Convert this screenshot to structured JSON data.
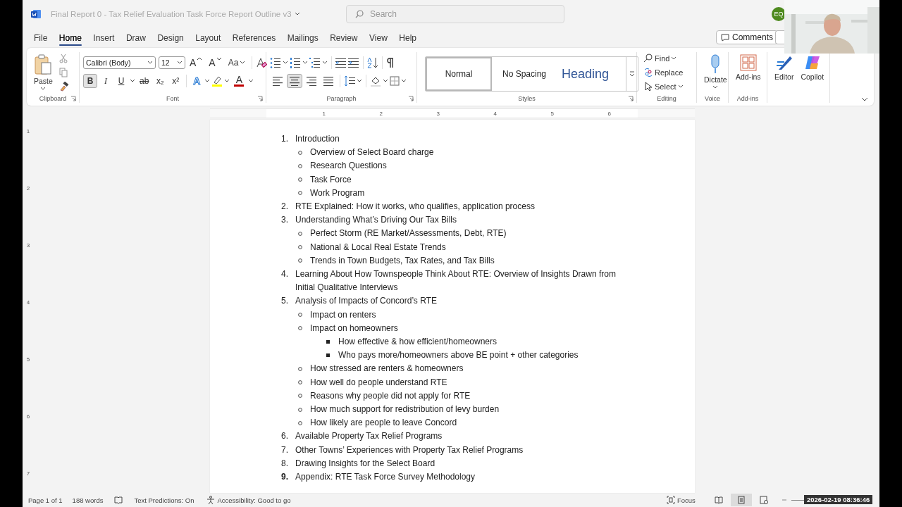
{
  "window": {
    "title": "Final Report 0 - Tax Relief Evaluation Task Force Report Outline v3",
    "search_placeholder": "Search",
    "user_initials": "EQ"
  },
  "menu": [
    {
      "label": "File",
      "selected": false
    },
    {
      "label": "Home",
      "selected": true
    },
    {
      "label": "Insert",
      "selected": false
    },
    {
      "label": "Draw",
      "selected": false
    },
    {
      "label": "Design",
      "selected": false
    },
    {
      "label": "Layout",
      "selected": false
    },
    {
      "label": "References",
      "selected": false
    },
    {
      "label": "Mailings",
      "selected": false
    },
    {
      "label": "Review",
      "selected": false
    },
    {
      "label": "View",
      "selected": false
    },
    {
      "label": "Help",
      "selected": false
    }
  ],
  "comments_button": "Comments",
  "ribbon": {
    "clipboard": {
      "label": "Clipboard",
      "paste": "Paste"
    },
    "font": {
      "label": "Font",
      "font_name": "Calibri (Body)",
      "font_size": "12",
      "size_buttons": [
        {
          "kind": "grow",
          "label": "A"
        },
        {
          "kind": "shrink",
          "label": "A"
        },
        {
          "kind": "case",
          "label": "Aa"
        }
      ],
      "toggles": [
        {
          "label": "B",
          "kind": "bold",
          "selected": true
        },
        {
          "label": "I",
          "kind": "italic",
          "selected": false
        },
        {
          "label": "U",
          "kind": "underline",
          "selected": false
        },
        {
          "label": "ab",
          "kind": "strike",
          "selected": false
        },
        {
          "label": "x₂",
          "kind": "sub",
          "selected": false
        },
        {
          "label": "x²",
          "kind": "sup",
          "selected": false
        }
      ],
      "color_buttons": [
        {
          "kind": "effects",
          "label": "A"
        },
        {
          "kind": "fontcolor",
          "label": "A"
        }
      ]
    },
    "paragraph": {
      "label": "Paragraph",
      "alignments": [
        {
          "kind": "left",
          "selected": false
        },
        {
          "kind": "center",
          "selected": true
        },
        {
          "kind": "right",
          "selected": false
        },
        {
          "kind": "justify",
          "selected": false
        }
      ]
    },
    "styles": {
      "label": "Styles",
      "items": [
        {
          "label": "Normal",
          "kind": "normal",
          "selected": true
        },
        {
          "label": "No Spacing",
          "kind": "nospacing",
          "selected": false
        },
        {
          "label": "Heading",
          "kind": "heading",
          "selected": false
        }
      ]
    },
    "editing": {
      "label": "Editing",
      "items": [
        {
          "label": "Find",
          "kind": "find"
        },
        {
          "label": "Replace",
          "kind": "replace"
        },
        {
          "label": "Select",
          "kind": "select"
        }
      ]
    },
    "voice": {
      "label": "Voice",
      "button": "Dictate"
    },
    "addins": {
      "label": "Add-ins",
      "button": "Add-ins"
    },
    "extra": [
      {
        "label": "Editor",
        "kind": "editor"
      },
      {
        "label": "Copilot",
        "kind": "copilot"
      }
    ]
  },
  "ruler": {
    "horizontal": [
      "1",
      "2",
      "3",
      "4",
      "5",
      "6"
    ],
    "vertical": [
      "1",
      "2",
      "3",
      "4",
      "5",
      "6",
      "7"
    ]
  },
  "document": {
    "outline": [
      {
        "marker": "1.",
        "bold_marker": false,
        "text": "Introduction",
        "children": [
          {
            "text": "Overview of Select Board charge"
          },
          {
            "text": "Research Questions"
          },
          {
            "text": "Task Force"
          },
          {
            "text": "Work Program"
          }
        ]
      },
      {
        "marker": "2.",
        "bold_marker": false,
        "text": "RTE Explained: How it works, who qualifies, application process"
      },
      {
        "marker": "3.",
        "bold_marker": false,
        "text": "Understanding What’s Driving Our Tax Bills",
        "children": [
          {
            "text": "Perfect Storm (RE Market/Assessments, Debt, RTE)"
          },
          {
            "text": "National & Local Real Estate Trends"
          },
          {
            "text": "Trends in Town Budgets, Tax Rates, and Tax Bills"
          }
        ]
      },
      {
        "marker": "4.",
        "bold_marker": false,
        "text": "Learning About How Townspeople Think About RTE: Overview of Insights Drawn from Initial Qualitative Interviews"
      },
      {
        "marker": "5.",
        "bold_marker": false,
        "text": "Analysis of Impacts of Concord’s RTE",
        "children": [
          {
            "text": "Impact on renters"
          },
          {
            "text": "Impact on homeowners",
            "children": [
              {
                "text": "How effective & how efficient/homeowners"
              },
              {
                "text": "Who pays more/homeowners above BE point + other categories"
              }
            ]
          },
          {
            "text": "How stressed are renters & homeowners"
          },
          {
            "text": "How well do people understand RTE"
          },
          {
            "text": "Reasons why people did not apply for RTE"
          },
          {
            "text": "How much support for redistribution of levy burden"
          },
          {
            "text": "How likely are people to leave Concord"
          }
        ]
      },
      {
        "marker": "6.",
        "bold_marker": false,
        "text": "Available Property Tax Relief Programs"
      },
      {
        "marker": "7.",
        "bold_marker": false,
        "text": "Other Towns’ Experiences with Property Tax Relief Programs"
      },
      {
        "marker": "8.",
        "bold_marker": false,
        "text": "Drawing Insights for the Select Board"
      },
      {
        "marker": "9.",
        "bold_marker": true,
        "text": "Appendix: RTE Task Force Survey Methodology"
      }
    ]
  },
  "status_bar": {
    "page": "Page 1 of 1",
    "words": "188 words",
    "predictions": "Text Predictions: On",
    "accessibility": "Accessibility: Good to go",
    "focus": "Focus",
    "views": [
      {
        "kind": "read",
        "selected": false
      },
      {
        "kind": "print",
        "selected": true
      },
      {
        "kind": "web",
        "selected": false
      }
    ]
  },
  "video": {
    "kind": "picture",
    "timestamp": "2026-02-19 08:36:46"
  }
}
